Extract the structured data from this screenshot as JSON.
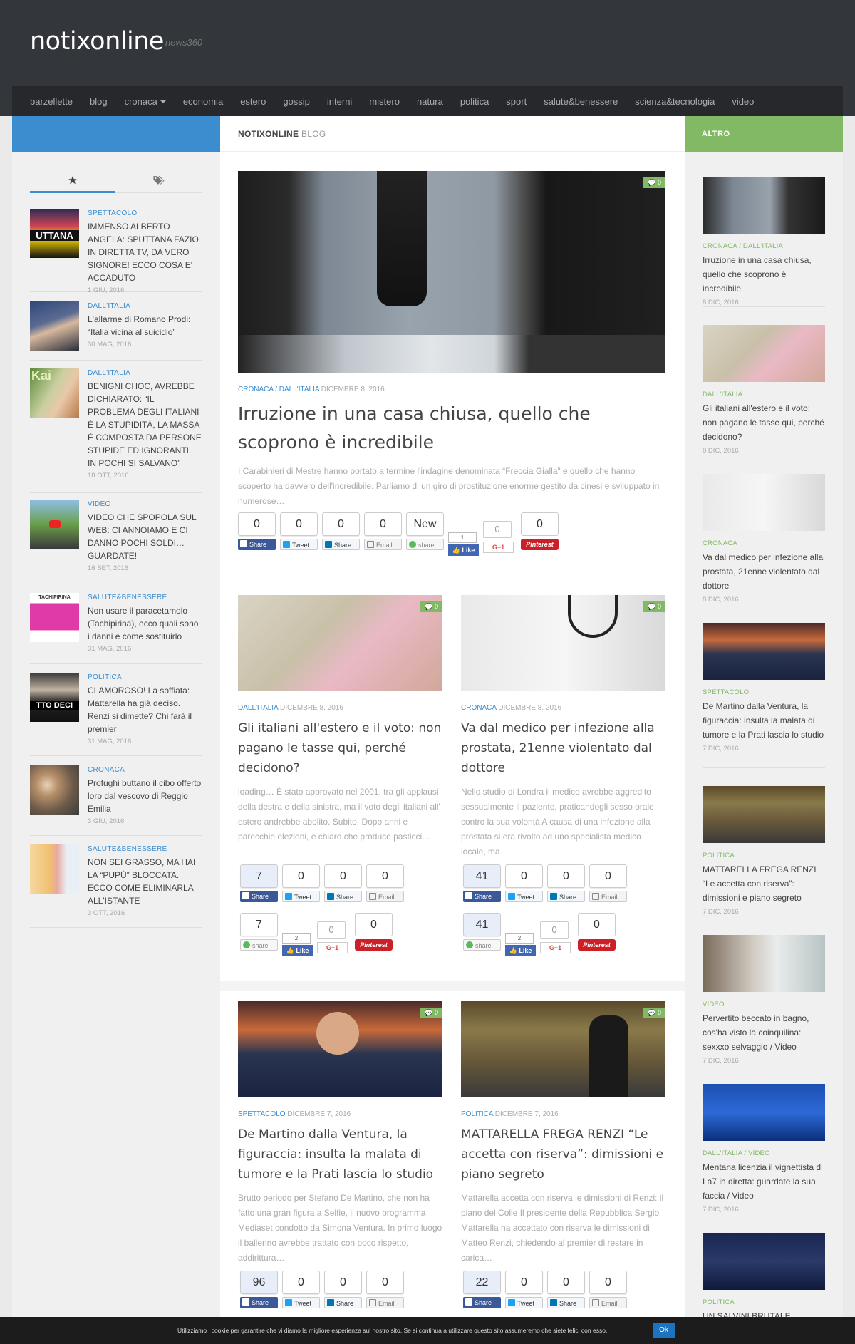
{
  "site": {
    "title": "notixonline",
    "tagline": "news360"
  },
  "nav": {
    "items": [
      "barzellette",
      "blog",
      "cronaca",
      "economia",
      "estero",
      "gossip",
      "interni",
      "mistero",
      "natura",
      "politica",
      "sport",
      "salute&benessere",
      "scienza&tecnologia",
      "video"
    ]
  },
  "breadcrumb": {
    "site": "NOTIXONLINE",
    "section": "BLOG"
  },
  "right_header": "ALTRO",
  "left_tabs": {
    "star": "star-icon",
    "tags": "tags-icon"
  },
  "left_items": [
    {
      "cat": "SPETTACOLO",
      "title": "IMMENSO ALBERTO ANGELA: SPUTTANA FAZIO IN DIRETTA TV, DA VERO SIGNORE! ECCO COSA E' ACCADUTO",
      "date": "1 GIU, 2016",
      "thumb_text": "UTTANA"
    },
    {
      "cat": "DALL'ITALIA",
      "title": "L'allarme di Romano Prodi: “Italia vicina al suicidio”",
      "date": "30 MAG, 2016"
    },
    {
      "cat": "DALL'ITALIA",
      "title": "BENIGNI CHOC, AVREBBE DICHIARATO: “IL PROBLEMA DEGLI ITALIANI È LA STUPIDITÀ, LA MASSA È COMPOSTA DA PERSONE STUPIDE ED IGNORANTI. IN POCHI SI SALVANO”",
      "date": "18 OTT, 2016",
      "thumb_text": "Kai"
    },
    {
      "cat": "VIDEO",
      "title": "VIDEO CHE SPOPOLA SUL WEB: CI ANNOIAMO E CI DANNO POCHI SOLDI… GUARDATE!",
      "date": "16 SET, 2016"
    },
    {
      "cat": "SALUTE&BENESSERE",
      "title": "Non usare il paracetamolo (Tachipirina), ecco quali sono i danni e come sostituirlo",
      "date": "31 MAG, 2016",
      "thumb_text": "TACHIPIRINA"
    },
    {
      "cat": "POLITICA",
      "title": "CLAMOROSO! La soffiata: Mattarella ha già deciso. Renzi si dimette? Chi farà il premier",
      "date": "31 MAG, 2016",
      "thumb_text": "TTO DECI"
    },
    {
      "cat": "CRONACA",
      "title": "Profughi buttano il cibo offerto loro dal vescovo di Reggio Emilia",
      "date": "3 GIU, 2016"
    },
    {
      "cat": "SALUTE&BENESSERE",
      "title": "NON SEI GRASSO, MA HAI LA “PUPÙ” BLOCCATA. ECCO COME ELIMINARLA ALL'ISTANTE",
      "date": "3 OTT, 2016"
    }
  ],
  "featured": {
    "comments": "0",
    "cat": "CRONACA / DALL'ITALIA",
    "date": "DICEMBRE 8, 2016",
    "title": "Irruzione in una casa chiusa, quello che scoprono è incredibile",
    "excerpt": "I Carabinieri di Mestre hanno portato a termine l'indagine denominata “Freccia Gialla” e quello che hanno scoperto ha davvero dell'incredibile. Parliamo di un giro di prostituzione enorme gestito da cinesi e sviluppato in numerose…",
    "shares": {
      "facebook": "0",
      "twitter": "0",
      "linkedin": "0",
      "email": "0",
      "share": "New",
      "like": "1",
      "gplus": "0",
      "pinterest": "0"
    }
  },
  "share_labels": {
    "facebook": "Share",
    "twitter": "Tweet",
    "linkedin": "Share",
    "email": "Email",
    "share": "share",
    "like": "Like",
    "gplus": "G+1",
    "pinterest": "Pinterest"
  },
  "posts": [
    {
      "comments": "0",
      "cat": "DALL'ITALIA",
      "date": "DICEMBRE 8, 2016",
      "title": "Gli italiani all'estero e il voto: non pagano le tasse qui, perché decidono?",
      "excerpt": "loading… È stato approvato nel 2001, tra gli applausi della destra e della sinistra, ma il voto degli italiani all' estero andrebbe abolito. Subito. Dopo anni e parecchie elezioni, è chiaro che produce pasticci…",
      "shares": {
        "facebook": "7",
        "twitter": "0",
        "linkedin": "0",
        "email": "0",
        "share": "7",
        "like": "2",
        "gplus": "0",
        "pinterest": "0"
      }
    },
    {
      "comments": "0",
      "cat": "CRONACA",
      "date": "DICEMBRE 8, 2016",
      "title": "Va dal medico per infezione alla prostata, 21enne violentato dal dottore",
      "excerpt": "Nello studio di Londra il medico avrebbe aggredito sessualmente il paziente, praticandogli sesso orale contro la sua volontà A causa di una infezione alla prostata si era rivolto ad uno specialista medico locale, ma…",
      "shares": {
        "facebook": "41",
        "twitter": "0",
        "linkedin": "0",
        "email": "0",
        "share": "41",
        "like": "2",
        "gplus": "0",
        "pinterest": "0"
      }
    },
    {
      "comments": "0",
      "cat": "SPETTACOLO",
      "date": "DICEMBRE 7, 2016",
      "title": "De Martino dalla Ventura, la figuraccia: insulta la malata di tumore e la Prati lascia lo studio",
      "excerpt": "Brutto periodo per Stefano De Martino, che non ha fatto una gran figura a Selfie, il nuovo programma Mediaset condotto da Simona Ventura. In primo luogo il ballerino avrebbe trattato con poco rispetto, addirittura…",
      "shares": {
        "facebook": "96",
        "twitter": "0",
        "linkedin": "0",
        "email": "0"
      }
    },
    {
      "comments": "0",
      "cat": "POLITICA",
      "date": "DICEMBRE 7, 2016",
      "title": "MATTARELLA FREGA RENZI “Le accetta con riserva”: dimissioni e piano segreto",
      "excerpt": "Mattarella accetta con riserva le dimissioni di Renzi: il piano del Colle Il presidente della Repubblica Sergio Mattarella ha accettato con riserva le dimissioni di Matteo Renzi, chiedendo al premier di restare in carica…",
      "shares": {
        "facebook": "22",
        "twitter": "0",
        "linkedin": "0",
        "email": "0"
      }
    }
  ],
  "right_items": [
    {
      "cat": "CRONACA / DALL'ITALIA",
      "title": "Irruzione in una casa chiusa, quello che scoprono è incredibile",
      "date": "8 DIC, 2016"
    },
    {
      "cat": "DALL'ITALIA",
      "title": "Gli italiani all'estero e il voto: non pagano le tasse qui, perché decidono?",
      "date": "8 DIC, 2016"
    },
    {
      "cat": "CRONACA",
      "title": "Va dal medico per infezione alla prostata, 21enne violentato dal dottore",
      "date": "8 DIC, 2016"
    },
    {
      "cat": "SPETTACOLO",
      "title": "De Martino dalla Ventura, la figuraccia: insulta la malata di tumore e la Prati lascia lo studio",
      "date": "7 DIC, 2016"
    },
    {
      "cat": "POLITICA",
      "title": "MATTARELLA FREGA RENZI “Le accetta con riserva”: dimissioni e piano segreto",
      "date": "7 DIC, 2016"
    },
    {
      "cat": "VIDEO",
      "title": "Pervertito beccato in bagno, cos'ha visto la coinquilina: sexxxo selvaggio / Video",
      "date": "7 DIC, 2016"
    },
    {
      "cat": "DALL'ITALIA / VIDEO",
      "title": "Mentana licenzia il vignettista di La7 in diretta: guardate la sua faccia / Video",
      "date": "7 DIC, 2016"
    },
    {
      "cat": "POLITICA",
      "title": "UN SALVINI BRUTALE “Mattarella…”",
      "date": ""
    }
  ],
  "cookie": {
    "message": "Utilizziamo i cookie per garantire che vi diamo la migliore esperienza sul nostro sito. Se si continua a utilizzare questo sito assumeremo che siete felici con esso.",
    "ok": "Ok"
  },
  "colors": {
    "header": "#33363b",
    "nav": "#26282c",
    "blue": "#3b8dd0",
    "green": "#82b965",
    "facebook": "#3b5998",
    "pinterest": "#cb2027"
  }
}
